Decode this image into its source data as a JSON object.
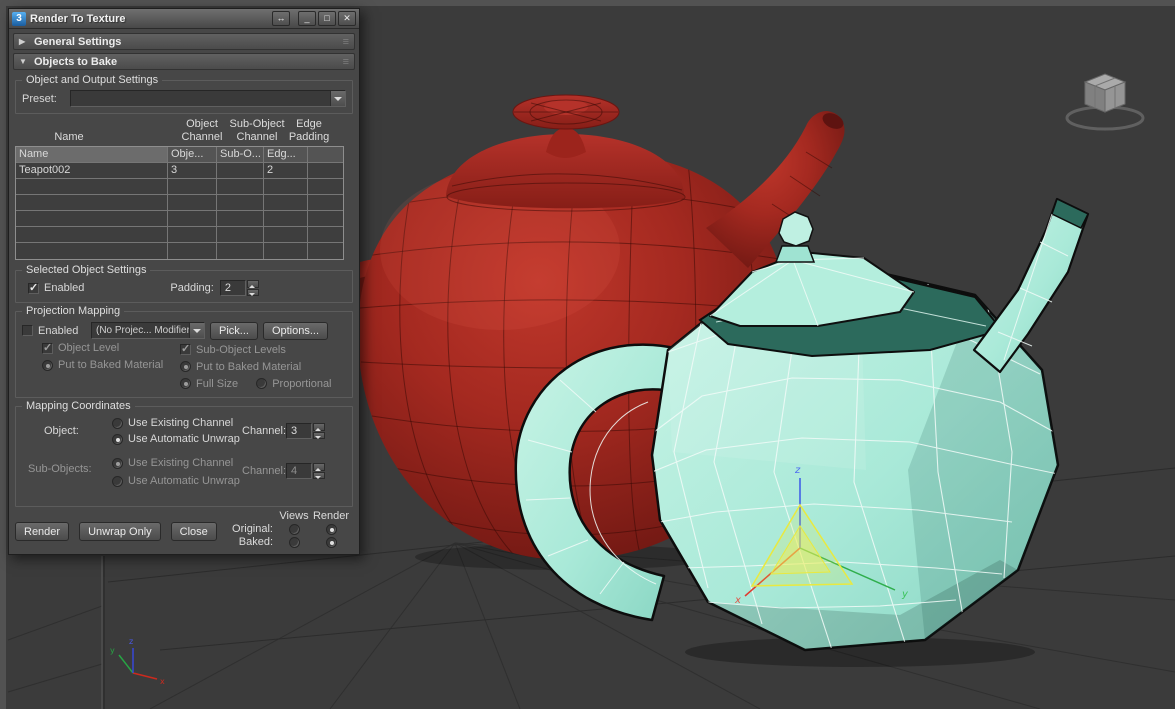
{
  "window": {
    "title": "Render To Texture",
    "controls": {
      "widen": "↔",
      "minimize": "_",
      "maximize": "□",
      "close": "✕"
    },
    "app_icon": "3"
  },
  "icons": {
    "collapsed": "▶",
    "expanded": "▼",
    "grip": "≡"
  },
  "rollouts": {
    "general": "General Settings",
    "bake": "Objects to Bake"
  },
  "object_output": {
    "label": "Object and Output Settings",
    "preset_label": "Preset:",
    "preset_value": ""
  },
  "table": {
    "col_headers": [
      [
        "Name",
        ""
      ],
      [
        "Object",
        "Channel"
      ],
      [
        "Sub-Object",
        "Channel"
      ],
      [
        "Edge",
        "Padding"
      ]
    ],
    "grid_headers": [
      "Name",
      "Obje...",
      "Sub-O...",
      "Edg..."
    ],
    "rows": [
      {
        "name": "Teapot002",
        "obj": "3",
        "sub": "",
        "edge": "2"
      },
      {
        "name": "",
        "obj": "",
        "sub": "",
        "edge": ""
      },
      {
        "name": "",
        "obj": "",
        "sub": "",
        "edge": ""
      },
      {
        "name": "",
        "obj": "",
        "sub": "",
        "edge": ""
      },
      {
        "name": "",
        "obj": "",
        "sub": "",
        "edge": ""
      },
      {
        "name": "",
        "obj": "",
        "sub": "",
        "edge": ""
      }
    ]
  },
  "selected_object": {
    "label": "Selected Object Settings",
    "enabled_label": "Enabled",
    "padding_label": "Padding:",
    "padding_value": "2"
  },
  "projection": {
    "label": "Projection Mapping",
    "enabled_label": "Enabled",
    "modifier_value": "(No Projec... Modifier)",
    "pick_label": "Pick...",
    "options_label": "Options...",
    "object_level": "Object Level",
    "sub_object_levels": "Sub-Object Levels",
    "put_baked_left": "Put to Baked Material",
    "put_baked_right": "Put to Baked Material",
    "full_size": "Full Size",
    "proportional": "Proportional"
  },
  "mapping": {
    "label": "Mapping Coordinates",
    "object_label": "Object:",
    "use_existing": "Use Existing Channel",
    "use_auto": "Use Automatic Unwrap",
    "channel_label": "Channel:",
    "object_channel": "3",
    "sub_objects_label": "Sub-Objects:",
    "sub_use_existing": "Use Existing Channel",
    "sub_use_auto": "Use Automatic Unwrap",
    "channel2_label": "Channel:",
    "sub_channel": "4"
  },
  "footer": {
    "render": "Render",
    "unwrap": "Unwrap Only",
    "close": "Close",
    "views": "Views",
    "render_col": "Render",
    "original": "Original:",
    "baked": "Baked:"
  },
  "viewport": {
    "axis_x": "x",
    "axis_y": "y",
    "axis_z": "z"
  },
  "states": {
    "selected_enabled": true,
    "proj_enabled": false,
    "object_level": true,
    "sub_object_levels": true,
    "put_baked_left": true,
    "put_baked_right": true,
    "full_size": true,
    "proportional": false,
    "use_existing": false,
    "use_auto": true,
    "sub_use_existing": true,
    "sub_use_auto": false,
    "views_original": false,
    "render_original": true,
    "views_baked": false,
    "render_baked": true
  },
  "colors": {
    "red_teapot": "#a42920",
    "cyan_teapot": "#a9e9d8",
    "gizmo_yellow": "#e9e93f",
    "axis_x": "#e04a3a",
    "axis_y": "#3cc45c",
    "axis_z": "#4f6cf0"
  }
}
